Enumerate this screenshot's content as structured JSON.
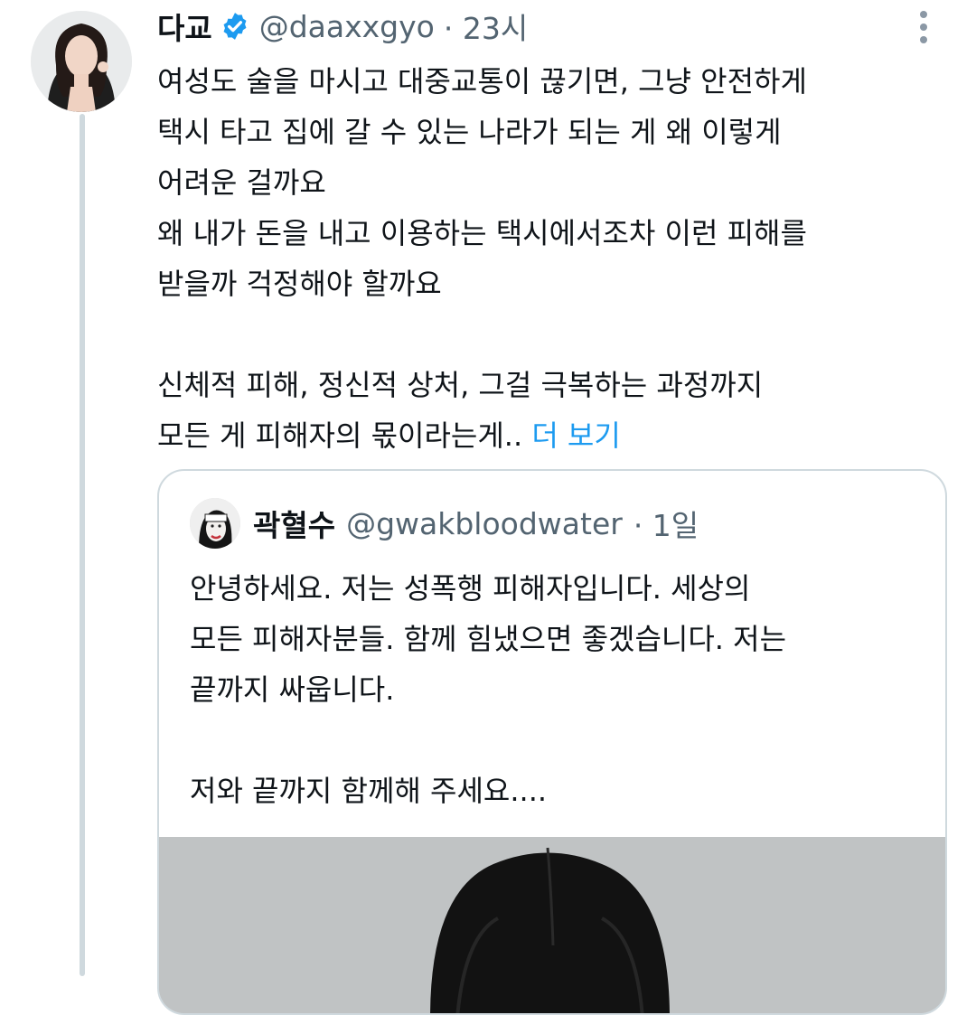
{
  "tweet": {
    "author_name": "다교",
    "handle": "@daaxxgyo",
    "time": "· 23시",
    "lines": [
      "여성도 술을 마시고 대중교통이 끊기면, 그냥 안전하게",
      "택시 타고 집에 갈 수 있는 나라가 되는 게 왜 이렇게",
      "어려운 걸까요",
      "왜 내가 돈을 내고 이용하는 택시에서조차 이런 피해를",
      "받을까 걱정해야 할까요",
      "신체적 피해, 정신적 상처, 그걸 극복하는 과정까지",
      "모든 게 피해자의 몫이라는게.."
    ],
    "show_more": "더 보기"
  },
  "quote": {
    "author_name": "곽혈수",
    "handle": "@gwakbloodwater",
    "time": "· 1일",
    "lines": [
      "안녕하세요. 저는 성폭행 피해자입니다. 세상의",
      "모든 피해자분들. 함께 힘냈으면 좋겠습니다. 저는",
      "끝까지 싸웁니다.",
      "저와 끝까지 함께해 주세요...."
    ]
  },
  "colors": {
    "verified": "#1d9bf0",
    "link": "#1d9bf0",
    "secondary_text": "#536471",
    "border": "#cfd9de"
  },
  "icons": [
    "verified-badge-icon",
    "more-options-icon"
  ]
}
